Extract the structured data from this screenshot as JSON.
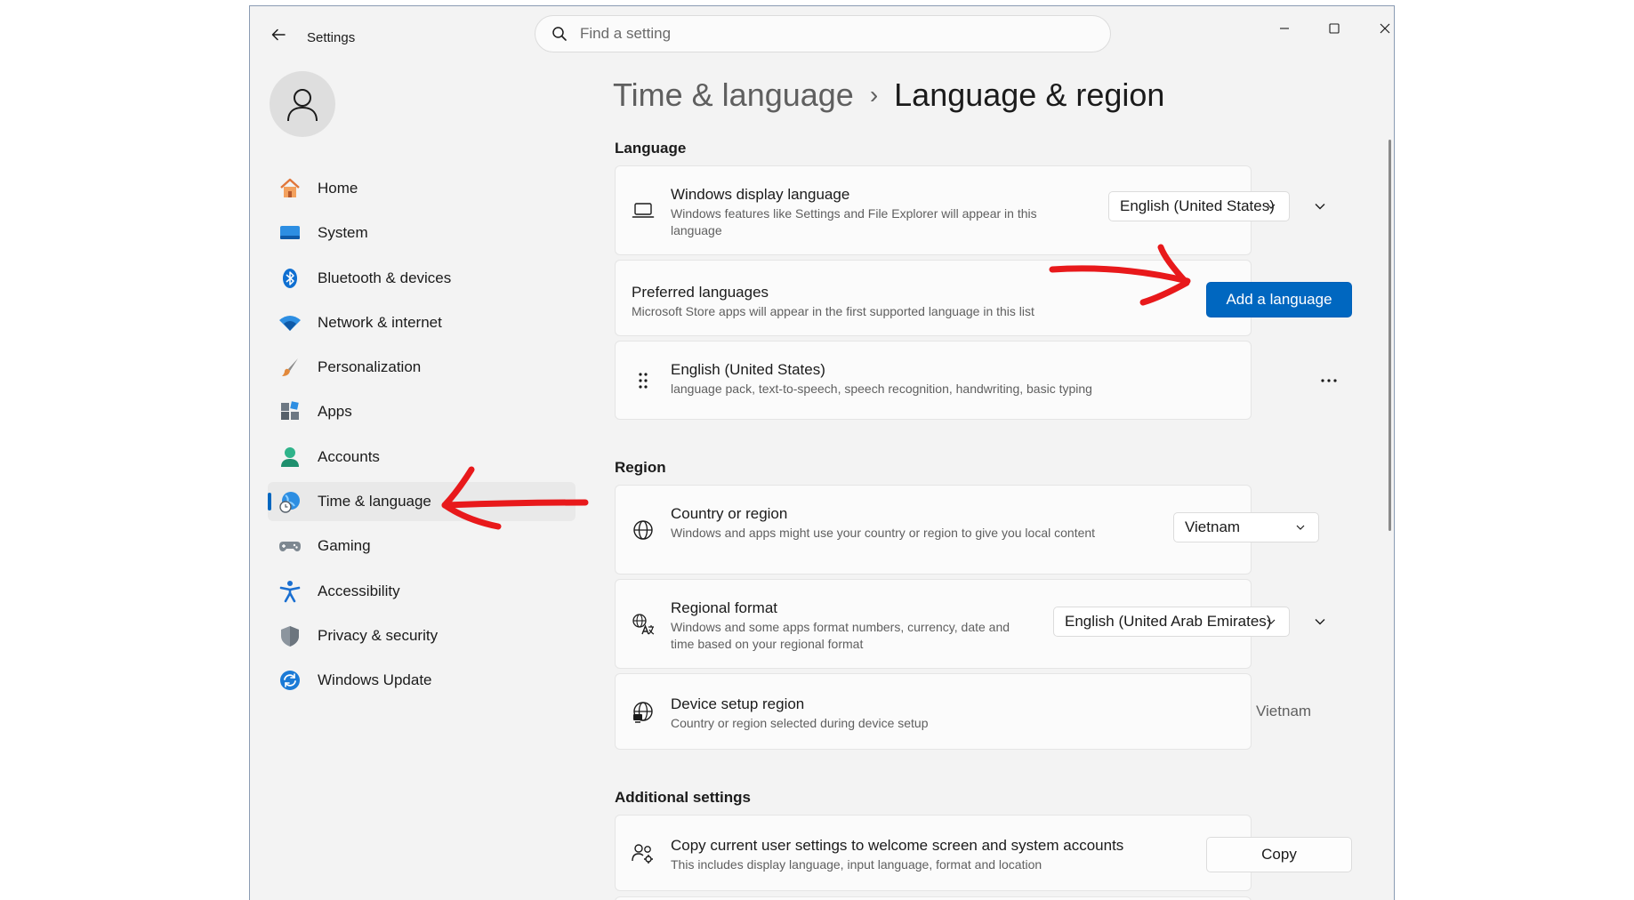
{
  "window": {
    "title": "Settings",
    "search_placeholder": "Find a setting"
  },
  "sidebar": {
    "items": [
      {
        "label": "Home",
        "icon": "home-icon"
      },
      {
        "label": "System",
        "icon": "system-icon"
      },
      {
        "label": "Bluetooth & devices",
        "icon": "bluetooth-icon"
      },
      {
        "label": "Network & internet",
        "icon": "wifi-icon"
      },
      {
        "label": "Personalization",
        "icon": "brush-icon"
      },
      {
        "label": "Apps",
        "icon": "apps-icon"
      },
      {
        "label": "Accounts",
        "icon": "person-icon"
      },
      {
        "label": "Time & language",
        "icon": "globe-clock-icon",
        "active": true
      },
      {
        "label": "Gaming",
        "icon": "gamepad-icon"
      },
      {
        "label": "Accessibility",
        "icon": "accessibility-icon"
      },
      {
        "label": "Privacy & security",
        "icon": "shield-icon"
      },
      {
        "label": "Windows Update",
        "icon": "update-icon"
      }
    ]
  },
  "breadcrumb": {
    "parent": "Time & language",
    "separator": "›",
    "current": "Language & region"
  },
  "language": {
    "section_title": "Language",
    "display_language": {
      "title": "Windows display language",
      "desc": "Windows features like Settings and File Explorer will appear in this language",
      "value": "English (United States)"
    },
    "preferred": {
      "title": "Preferred languages",
      "desc": "Microsoft Store apps will appear in the first supported language in this list",
      "button": "Add a language"
    },
    "installed": {
      "title": "English (United States)",
      "desc": "language pack, text-to-speech, speech recognition, handwriting, basic typing"
    }
  },
  "region": {
    "section_title": "Region",
    "country": {
      "title": "Country or region",
      "desc": "Windows and apps might use your country or region to give you local content",
      "value": "Vietnam"
    },
    "format": {
      "title": "Regional format",
      "desc": "Windows and some apps format numbers, currency, date and time based on your regional format",
      "value": "English (United Arab Emirates)"
    },
    "device_setup": {
      "title": "Device setup region",
      "desc": "Country or region selected during device setup",
      "value": "Vietnam"
    }
  },
  "additional": {
    "section_title": "Additional settings",
    "copy_settings": {
      "title": "Copy current user settings to welcome screen and system accounts",
      "desc": "This includes display language, input language, format and location",
      "button": "Copy"
    }
  },
  "colors": {
    "accent": "#0067c0",
    "annotation": "#e8191b"
  }
}
